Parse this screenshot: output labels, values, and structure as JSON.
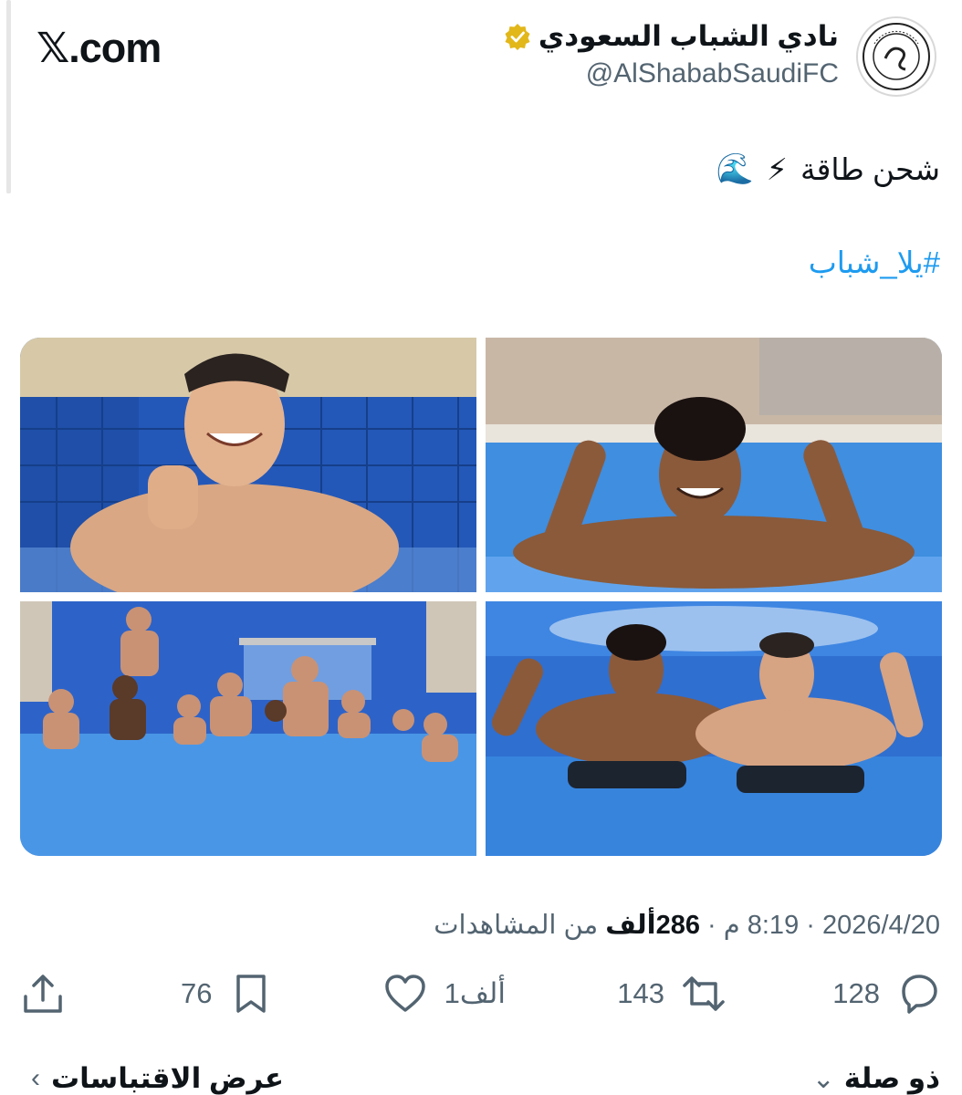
{
  "site": {
    "brand": "𝕏.com"
  },
  "author": {
    "display_name": "نادي الشباب السعودي",
    "handle": "@AlShababSaudiFC",
    "verified": true,
    "badge_color": "#e2b719"
  },
  "tweet": {
    "text": "شحن طاقة",
    "emojis": [
      "⚡",
      "🌊"
    ],
    "hashtag": "#يلا_شباب"
  },
  "media": {
    "count": 4,
    "colors": {
      "pool": "#2f6fd0",
      "water": "#3a8ae0"
    }
  },
  "meta": {
    "date": "2026/4/20",
    "separator": " · ",
    "time": "8:19 م",
    "views_count": "286ألف",
    "views_suffix": " من المشاهدات"
  },
  "actions": {
    "reply_count": "128",
    "retweet_count": "143",
    "like_count": "1ألف",
    "bookmark_count": "76"
  },
  "footer": {
    "quotes_label": "عرض الاقتباسات",
    "related_label": "ذو صلة"
  },
  "colors": {
    "text": "#0f1419",
    "muted": "#536471",
    "link": "#1d9bf0"
  }
}
